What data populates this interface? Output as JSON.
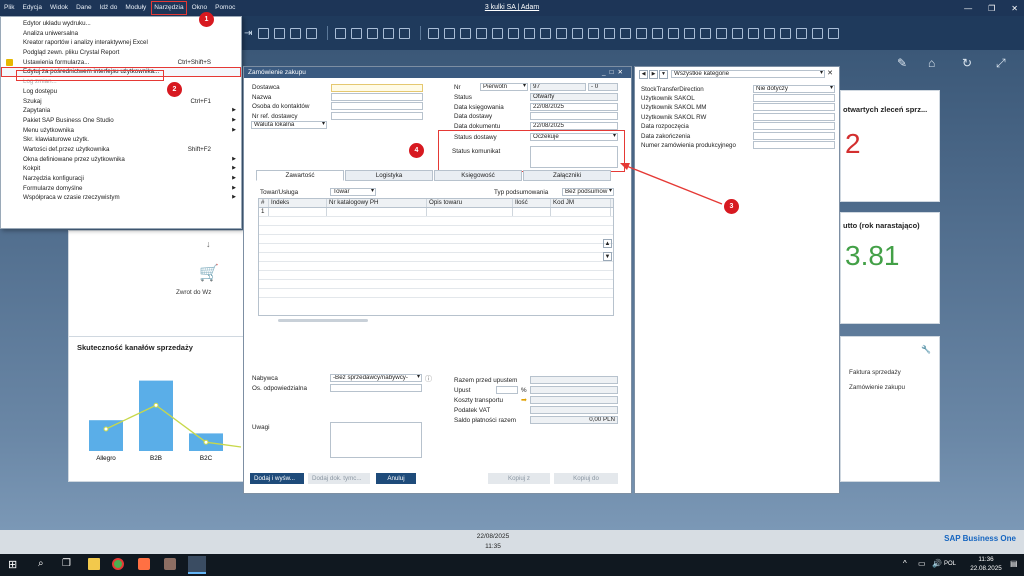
{
  "app": {
    "title": "3 kulki SA | Adam"
  },
  "menu": [
    "Plik",
    "Edycja",
    "Widok",
    "Dane",
    "Idź do",
    "Moduły",
    "Narzędzia",
    "Okno",
    "Pomoc"
  ],
  "dropdown": {
    "items": [
      {
        "label": "Edytor układu wydruku...",
        "shortcut": "",
        "arrow": false
      },
      {
        "label": "Analiza uniwersalna",
        "shortcut": "",
        "arrow": false
      },
      {
        "label": "Kreator raportów i analizy interaktywnej Excel",
        "shortcut": "",
        "arrow": false
      },
      {
        "label": "Podgląd zewn. pliku Crystal Report",
        "shortcut": "",
        "arrow": false
      },
      {
        "label": "Ustawienia formularza...",
        "shortcut": "Ctrl+Shift+S",
        "arrow": false
      },
      {
        "label": "Edytuj za pośrednictwem interfejsu użytkownika...",
        "shortcut": "",
        "arrow": false
      },
      {
        "label": "Log zmian...",
        "shortcut": "",
        "arrow": false
      },
      {
        "label": "Log dostępu",
        "shortcut": "",
        "arrow": false
      },
      {
        "label": "Szukaj",
        "shortcut": "Ctrl+F1",
        "arrow": false
      },
      {
        "label": "Zapytania",
        "shortcut": "",
        "arrow": true
      },
      {
        "label": "Pakiet SAP Business One Studio",
        "shortcut": "",
        "arrow": true
      },
      {
        "label": "Menu użytkownika",
        "shortcut": "",
        "arrow": true
      },
      {
        "label": "Skr. klawiaturowe użytk.",
        "shortcut": "",
        "arrow": false
      },
      {
        "label": "Wartości def.przez użytkownika",
        "shortcut": "Shift+F2",
        "arrow": false
      },
      {
        "label": "Okna definiowane przez użytkownika",
        "shortcut": "",
        "arrow": true
      },
      {
        "label": "Kokpit",
        "shortcut": "",
        "arrow": true
      },
      {
        "label": "Narzędzia konfiguracji",
        "shortcut": "",
        "arrow": true
      },
      {
        "label": "Formularze domyślne",
        "shortcut": "",
        "arrow": true
      },
      {
        "label": "Współpraca w czasie rzeczywistym",
        "shortcut": "",
        "arrow": true
      }
    ]
  },
  "cockpit": {
    "zwrot_label": "Zwrot do Wz",
    "widget1_title": "otwartych zleceń sprz...",
    "widget1_value": "2",
    "widget2_title": "utto (rok narastająco)",
    "widget2_value": "3.81",
    "chart_title": "Skuteczność kanałów sprzedaży",
    "shortcut1": "Faktura sprzedaży",
    "shortcut2": "Zamówienie zakupu"
  },
  "chart_data": {
    "type": "bar",
    "title": "Skuteczność kanałów sprzedaży",
    "categories": [
      "Allegro",
      "B2B",
      "B2C"
    ],
    "values": [
      35,
      80,
      20
    ],
    "line_values": [
      25,
      52,
      10
    ],
    "ylim": [
      0,
      100
    ],
    "colors": {
      "bar": "#5aaee8",
      "line": "#c8d84a"
    }
  },
  "po": {
    "title": "Zamówienie zakupu",
    "left_labels": [
      "Dostawca",
      "Nazwa",
      "Osoba do kontaktów",
      "Nr ref. dostawcy"
    ],
    "currency": "Waluta lokalna",
    "nr_label": "Nr",
    "nr_series": "Pierwotn",
    "nr_value": "97",
    "nr_suffix": "- 0",
    "right_labels": [
      "Status",
      "Data księgowania",
      "Data dostawy",
      "Data dokumentu"
    ],
    "status": "Otwarty",
    "data_ksiegowania": "22/08/2025",
    "data_dokumentu": "22/08/2025",
    "status_dostawy_label": "Status dostawy",
    "status_dostawy_value": "Oczekuje",
    "status_komunikat_label": "Status komunikat",
    "tabs": [
      "Zawartość",
      "Logistyka",
      "Księgowość",
      "Załączniki"
    ],
    "item_type_label": "Towar/Usługa",
    "item_type_value": "Towar",
    "summary_type_label": "Typ podsumowania",
    "summary_type_value": "Bez podsumow",
    "grid_headers": [
      "#",
      "Indeks",
      "Nr katalogowy PH",
      "Opis towaru",
      "Ilość",
      "Kod JM"
    ],
    "first_row": "1",
    "nabywca_label": "Nabywca",
    "nabywca_value": "-Bez sprzedawcy/nabywcy-",
    "os_odp_label": "Os. odpowiedzialna",
    "uwagi_label": "Uwagi",
    "totals_labels": [
      "Razem przed upustem",
      "Upust",
      "Koszty transportu",
      "Podatek VAT",
      "Saldo płatności razem"
    ],
    "percent": "%",
    "saldo_value": "0,00 PLN",
    "btn_add": "Dodaj i wyśw...",
    "btn_add_doc": "Dodaj dok. tymc...",
    "btn_cancel": "Anuluj",
    "btn_copy_from": "Kopiuj z",
    "btn_copy_to": "Kopiuj do"
  },
  "udf": {
    "category": "Wszystkie kategorie",
    "fields": [
      {
        "label": "StockTransferDirection",
        "value": "Nie dotyczy"
      },
      {
        "label": "Użytkownik SAKOL",
        "value": ""
      },
      {
        "label": "Użytkownik SAKOL MM",
        "value": ""
      },
      {
        "label": "Użytkownik SAKOL RW",
        "value": ""
      },
      {
        "label": "Data rozpoczęcia",
        "value": ""
      },
      {
        "label": "Data zakończenia",
        "value": ""
      },
      {
        "label": "Numer zamówienia produkcyjnego",
        "value": ""
      }
    ]
  },
  "badges": [
    "1",
    "2",
    "3",
    "4"
  ],
  "statusbar": {
    "date": "22/08/2025",
    "time": "11:35"
  },
  "taskbar": {
    "time": "11:36",
    "date": "22.08.2025",
    "lang": "POL"
  },
  "sap_logo": "SAP Business One"
}
